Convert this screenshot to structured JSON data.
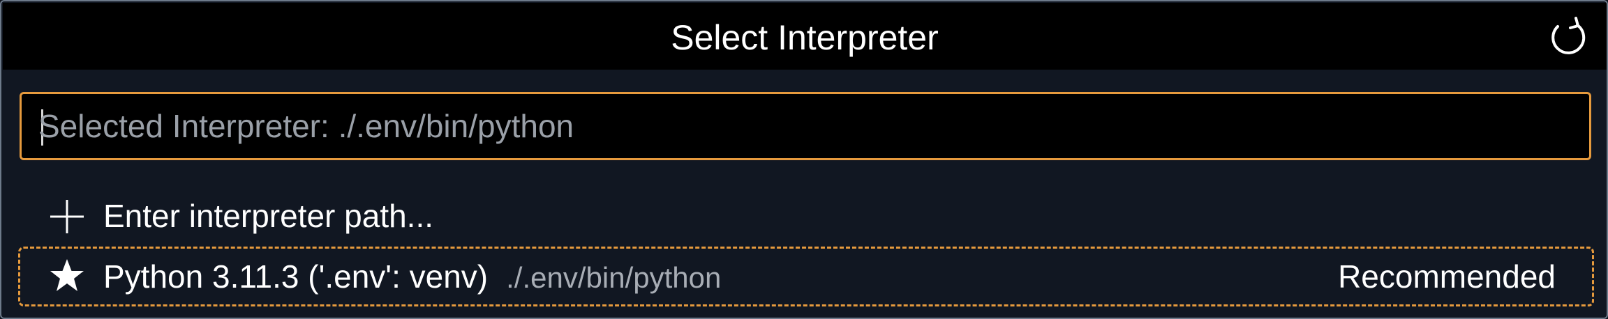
{
  "header": {
    "title": "Select Interpreter",
    "refresh_icon": "refresh-icon"
  },
  "input": {
    "placeholder": "Selected Interpreter: ./.env/bin/python",
    "value": ""
  },
  "items": [
    {
      "icon": "plus-icon",
      "label": "Enter interpreter path..."
    },
    {
      "icon": "star-icon",
      "label": "Python 3.11.3 ('.env': venv)",
      "description": "./.env/bin/python",
      "badge": "Recommended"
    }
  ],
  "colors": {
    "accent": "#e69a3d",
    "background": "#111722",
    "titlebar": "#000000",
    "text": "#ffffff",
    "muted_text": "#a8adb5"
  }
}
